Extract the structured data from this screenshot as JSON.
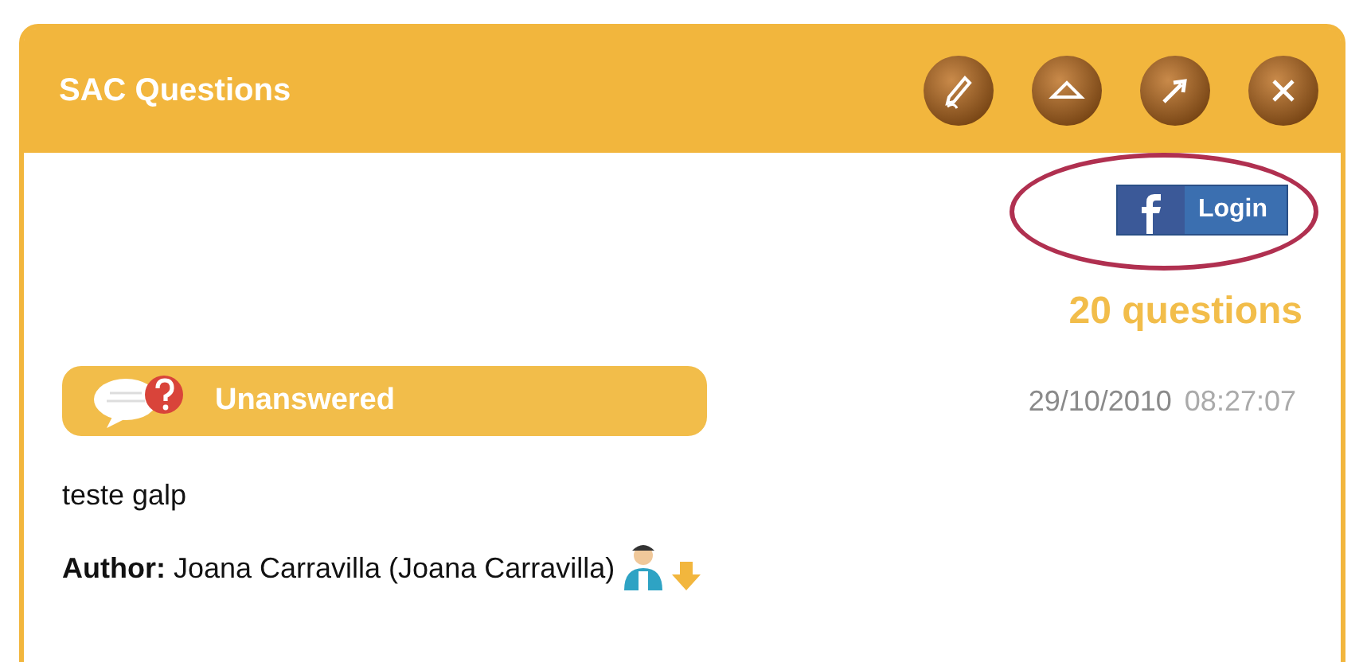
{
  "window": {
    "title": "SAC Questions"
  },
  "header_buttons": [
    {
      "kind": "edit"
    },
    {
      "kind": "collapse"
    },
    {
      "kind": "popout"
    },
    {
      "kind": "close"
    }
  ],
  "login": {
    "label": "Login",
    "highlighted": true
  },
  "count": "20 questions",
  "question": {
    "status": "Unanswered",
    "date": "29/10/2010",
    "time": "08:27:07",
    "text": "teste galp",
    "author_label": "Author:",
    "author": "Joana Carravilla (Joana Carravilla)"
  }
}
